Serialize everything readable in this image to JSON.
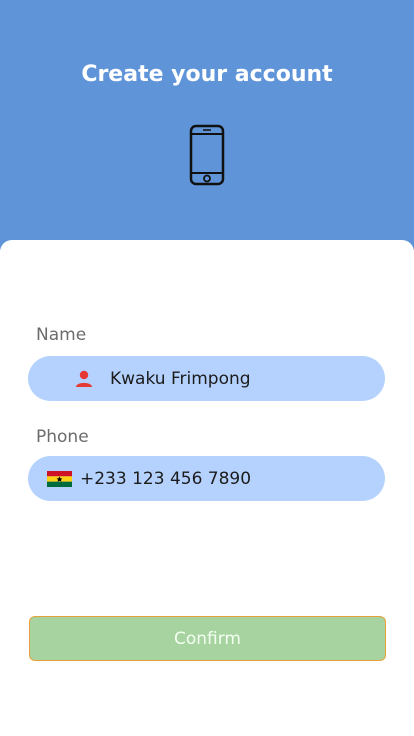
{
  "header": {
    "title": "Create your account",
    "icon": "smartphone-icon",
    "background_color": "#5f95d8"
  },
  "form": {
    "name": {
      "label": "Name",
      "value": "Kwaku Frimpong",
      "icon": "person-icon",
      "icon_color": "#e53935"
    },
    "phone": {
      "label": "Phone",
      "value": "+233 123 456 7890",
      "icon": "ghana-flag-icon"
    },
    "field_background": "#b5d2ff"
  },
  "confirm": {
    "label": "Confirm",
    "background_color": "#a7d3a0",
    "border_color": "#e8a13a"
  }
}
